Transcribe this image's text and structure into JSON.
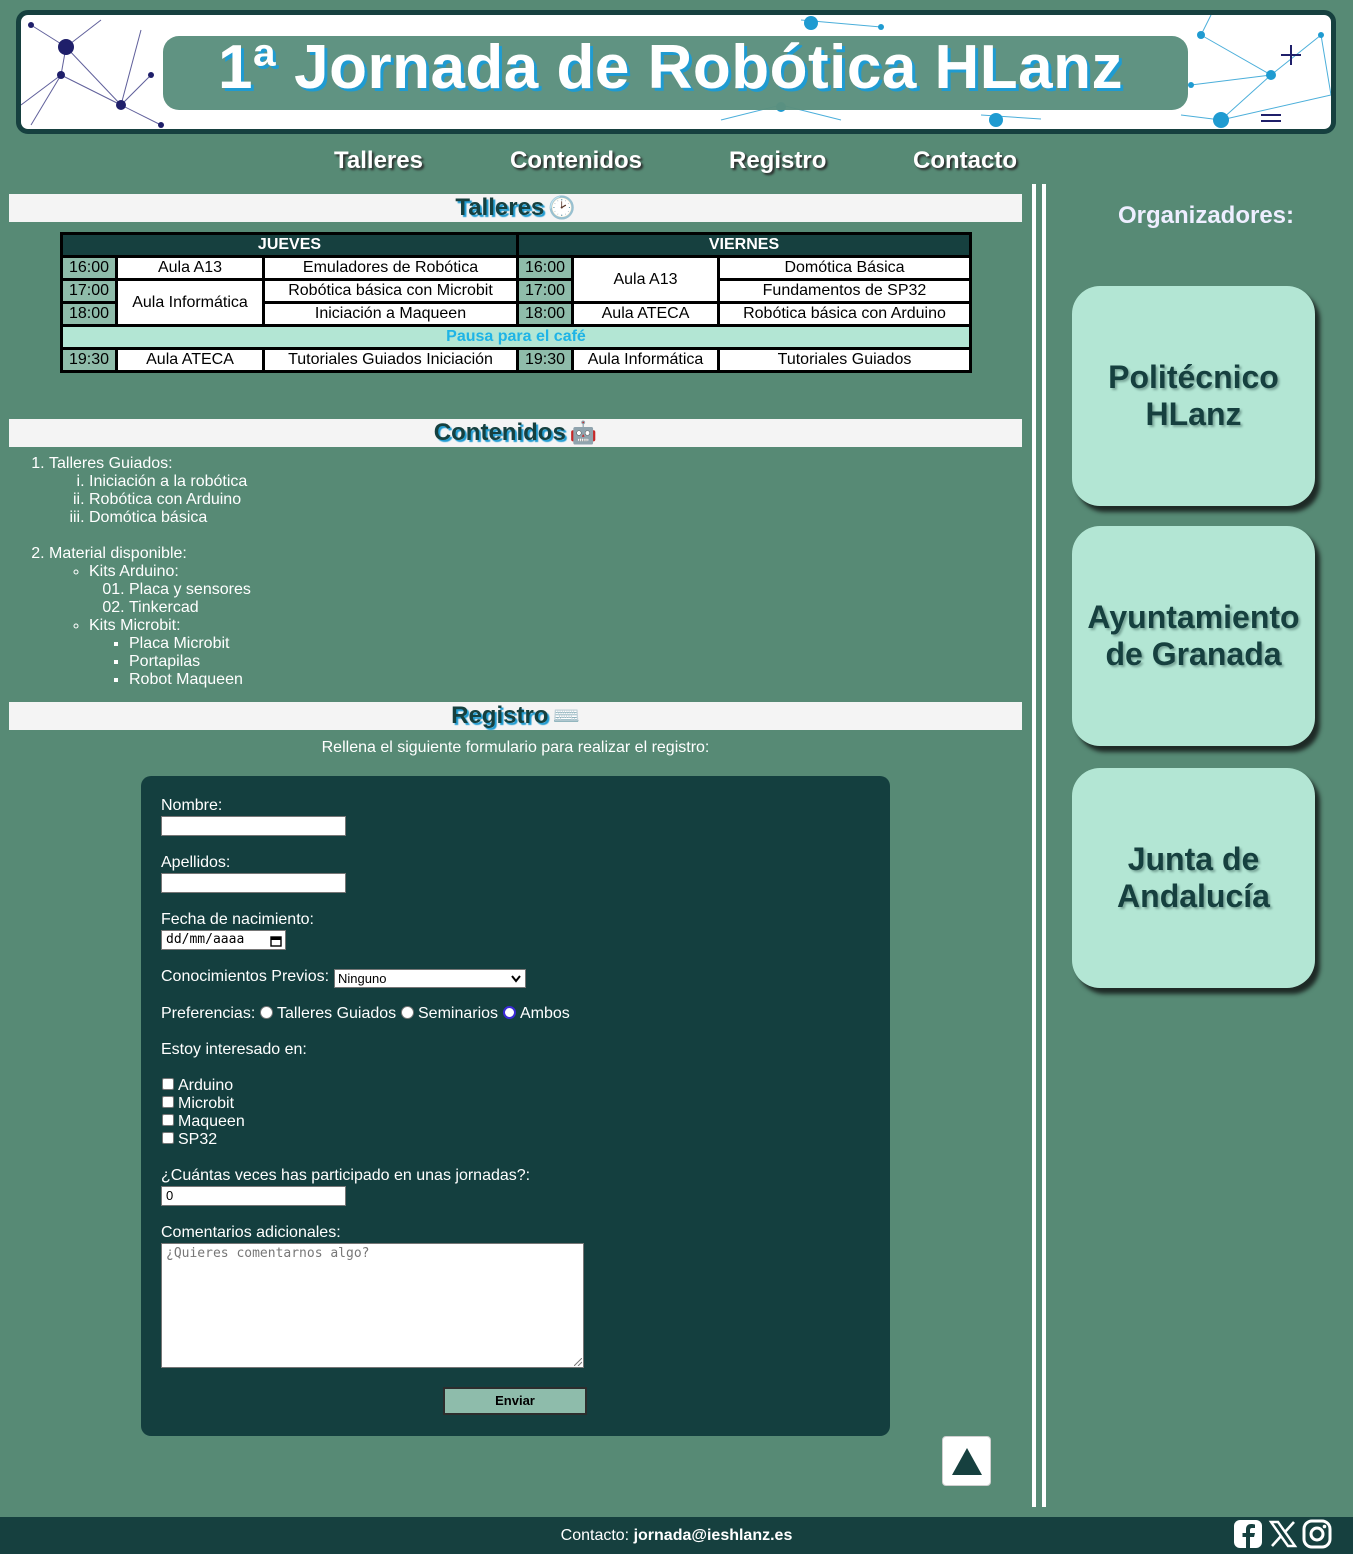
{
  "header": {
    "title": "1ª Jornada de Robótica HLanz"
  },
  "nav": [
    {
      "label": "Talleres"
    },
    {
      "label": "Contenidos"
    },
    {
      "label": "Registro"
    },
    {
      "label": "Contacto"
    }
  ],
  "sections": {
    "talleres": {
      "title": "Talleres",
      "emoji": "🕑"
    },
    "contenidos": {
      "title": "Contenidos",
      "emoji": "🤖"
    },
    "registro": {
      "title": "Registro",
      "emoji": "⌨️"
    }
  },
  "schedule": {
    "days": [
      "JUEVES",
      "VIERNES"
    ],
    "jueves": [
      {
        "time": "16:00",
        "room": "Aula A13",
        "workshop": "Emuladores de Robótica"
      },
      {
        "time": "17:00",
        "room": "Aula Informática",
        "workshop": "Robótica básica con Microbit"
      },
      {
        "time": "18:00",
        "room": "",
        "workshop": "Iniciación a Maqueen"
      },
      {
        "time": "19:30",
        "room": "Aula ATECA",
        "workshop": "Tutoriales Guiados Iniciación"
      }
    ],
    "viernes": [
      {
        "time": "16:00",
        "room": "Aula A13",
        "workshop": "Domótica Básica"
      },
      {
        "time": "17:00",
        "room": "",
        "workshop": "Fundamentos de SP32"
      },
      {
        "time": "18:00",
        "room": "Aula ATECA",
        "workshop": "Robótica básica con Arduino"
      },
      {
        "time": "19:30",
        "room": "Aula Informática",
        "workshop": "Tutoriales Guiados"
      }
    ],
    "pause": "Pausa para el café"
  },
  "contents": {
    "item1": "Talleres Guiados:",
    "item1_sub": [
      "Iniciación a la robótica",
      "Robótica con Arduino",
      "Domótica básica"
    ],
    "item2": "Material disponible:",
    "arduino": "Kits Arduino:",
    "arduino_sub": [
      "Placa y sensores",
      "Tinkercad"
    ],
    "microbit": "Kits Microbit:",
    "microbit_sub": [
      "Placa Microbit",
      "Portapilas",
      "Robot Maqueen"
    ]
  },
  "registration": {
    "intro": "Rellena el siguiente formulario para realizar el registro:",
    "name_label": "Nombre:",
    "name_value": "",
    "surname_label": "Apellidos:",
    "surname_value": "",
    "birth_label": "Fecha de nacimiento:",
    "birth_placeholder": "dd/mm/aaaa",
    "knowledge_label": "Conocimientos Previos:",
    "knowledge_value": "Ninguno",
    "prefs_label": "Preferencias:",
    "prefs_options": [
      "Talleres Guiados",
      "Seminarios",
      "Ambos"
    ],
    "prefs_selected": "Ambos",
    "interest_label": "Estoy interesado en:",
    "interest_options": [
      "Arduino",
      "Microbit",
      "Maqueen",
      "SP32"
    ],
    "times_label": "¿Cuántas veces has participado en unas jornadas?:",
    "times_value": "0",
    "comments_label": "Comentarios adicionales:",
    "comments_placeholder": "¿Quieres comentarnos algo?",
    "submit": "Enviar"
  },
  "sidebar": {
    "title": "Organizadores:",
    "orgs": [
      {
        "name": "Politécnico HLanz"
      },
      {
        "name": "Ayuntamiento de Granada"
      },
      {
        "name": "Junta de Andalucía"
      }
    ]
  },
  "footer": {
    "label": "Contacto:",
    "email": "jornada@ieshlanz.es",
    "social_icons": [
      "facebook-icon",
      "x-icon",
      "instagram-icon"
    ]
  },
  "colors": {
    "background": "#578a75",
    "dark": "#16403f",
    "mint": "#b3e6d4",
    "accent_blue": "#1f9bd1"
  }
}
